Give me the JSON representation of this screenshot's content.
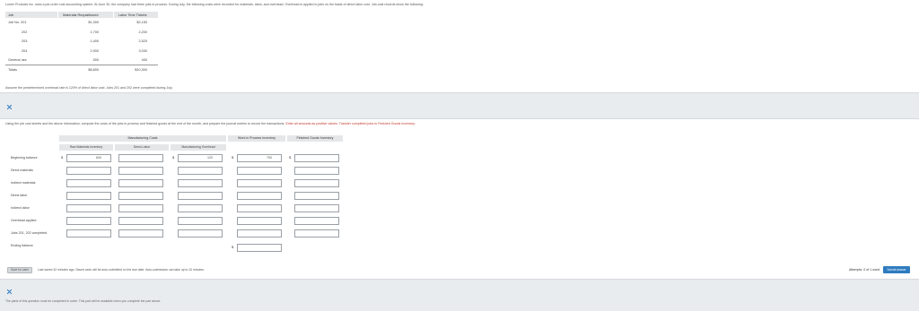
{
  "top": {
    "intro": "Lonier Products Inc. uses a job-order cost accounting system. At June 30, the company had three jobs in process. During July, the following costs were recorded for materials, labor, and overhead. Overhead is applied to jobs on the basis of direct labor cost. Job-cost records show the following:",
    "table": {
      "headers": [
        "Job",
        "Materials Requisitioned",
        "Labor Time Tickets"
      ],
      "rows": [
        [
          "Job No. 201",
          "$1,300",
          "$2,150"
        ],
        [
          "202",
          "1,700",
          "2,200"
        ],
        [
          "203",
          "1,400",
          "2,520"
        ],
        [
          "204",
          "2,900",
          "3,030"
        ],
        [
          "General use",
          "500",
          "400"
        ],
        [
          "Totals",
          "$8,800",
          "$10,300"
        ]
      ]
    },
    "note": "Assume the predetermined overhead rate is 120% of direct labor cost. Jobs 201 and 202 were completed during July."
  },
  "middle": {
    "instruction": "Using the job cost sheets and the above information, compute the costs of the jobs in process and finished goods at the end of the month, and prepare the journal entries to record the transactions. ",
    "instruction_red": "Enter all amounts as positive values. Transfer completed jobs to Finished Goods Inventory.",
    "group_header": "Manufacturing Costs",
    "headers": {
      "raw_materials": "Raw Materials Inventory",
      "direct_labor": "Direct Labor",
      "mfg_overhead": "Manufacturing Overhead",
      "wip": "Work in Process Inventory",
      "finished_goods": "Finished Goods Inventory"
    },
    "rows": [
      {
        "label": "Beginning balance",
        "values": [
          "600",
          "",
          "120",
          "750",
          ""
        ]
      },
      {
        "label": "Direct materials",
        "values": [
          "",
          "",
          "",
          "",
          ""
        ]
      },
      {
        "label": "Indirect materials",
        "values": [
          "",
          "",
          "",
          "",
          ""
        ]
      },
      {
        "label": "Direct labor",
        "values": [
          "",
          "",
          "",
          "",
          ""
        ]
      },
      {
        "label": "Indirect labor",
        "values": [
          "",
          "",
          "",
          "",
          ""
        ]
      },
      {
        "label": "Overhead applied",
        "values": [
          "",
          "",
          "",
          "",
          ""
        ]
      },
      {
        "label": "Jobs 201, 202 completed",
        "values": [
          "",
          "",
          "",
          "",
          ""
        ]
      },
      {
        "label": "Ending balance",
        "values": [
          "",
          "",
          "",
          "",
          ""
        ]
      }
    ]
  },
  "footer": {
    "save_label": "Save for Later",
    "save_note": "Last saved 42 minutes ago. Saved work will be auto-submitted on the due date. Auto-submission can take up to 10 minutes.",
    "attempts": "Attempts: 0 of 1 used",
    "submit_label": "Submit Answer",
    "bottom_note": "The parts of this question must be completed in order. This part will be available when you complete the part above."
  },
  "colors": {
    "accent": "#2e7bbf",
    "instruction_red": "#c0392b",
    "panel": "#ffffff",
    "background": "#e9ecef"
  }
}
